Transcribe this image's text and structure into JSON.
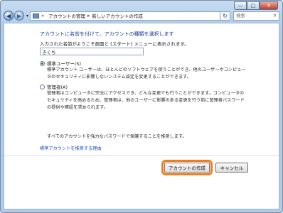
{
  "window": {
    "minimize_glyph": "—",
    "maximize_glyph": "□",
    "close_glyph": "✕"
  },
  "nav": {
    "back_glyph": "◀",
    "forward_glyph": "▶",
    "dropdown_glyph": "▾",
    "address_prefix": "«",
    "breadcrumb": [
      "アカウントの管理",
      "新しいアカウントの作成"
    ],
    "breadcrumb_sep": "▸",
    "refresh_glyph": "↻",
    "search_placeholder": "検索",
    "search_icon": "search-icon"
  },
  "form": {
    "heading": "アカウントに名前を付けて、アカウントの種類を選択します",
    "name_prompt": "入力された名前がようこそ画面と [スタート] メニューに表示されます。",
    "name_value": "きくち",
    "account_types": [
      {
        "label": "標準ユーザー(S)",
        "checked": true,
        "description": "標準アカウント ユーザーは、ほとんどのソフトウェアを使うことができ、他のユーザーやコンピュータのセキュリティに影響しないシステム設定を変更することができます。"
      },
      {
        "label": "管理者(A)",
        "checked": false,
        "description": "管理者はコンピュータに完全にアクセスでき、どんな変更でも行うことができます。コンピュータのセキュリティを高めるため、管理者は、他のユーザーに影響のある変更を行う前に管理者パスワードの提供や確認を求められます。"
      }
    ],
    "password_note": "すべてのアカウントを強力なパスワードで保護することを推奨します。",
    "recommend_link": "標準アカウントを推奨する理由"
  },
  "buttons": {
    "create": "アカウントの作成",
    "cancel": "キャンセル"
  },
  "colors": {
    "heading": "#1c3b95",
    "link": "#1f4fb4",
    "highlight": "#ef7d1a"
  }
}
